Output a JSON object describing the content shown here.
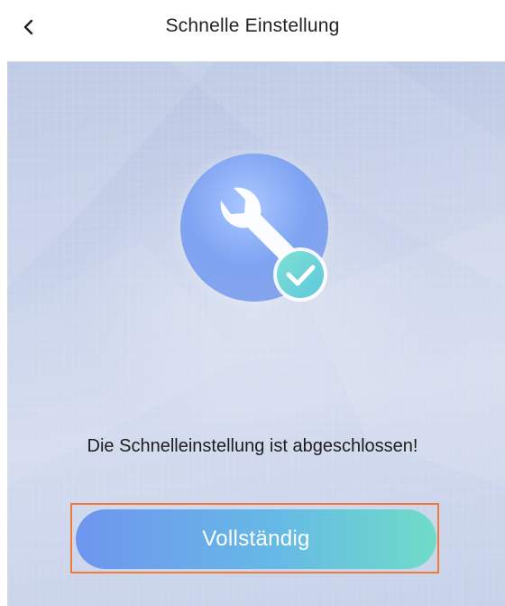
{
  "header": {
    "title": "Schnelle Einstellung",
    "back_icon": "chevron-left-icon"
  },
  "main": {
    "hero_icons": [
      "wrench-icon",
      "checkmark-icon"
    ],
    "message": "Die Schnelleinstellung ist abgeschlossen!",
    "complete_button_label": "Vollständig"
  },
  "colors": {
    "button_gradient_start": "#6f95ee",
    "button_gradient_end": "#6fdcc7",
    "highlight_border": "#f07a3a",
    "background": "#c9d3ea"
  }
}
